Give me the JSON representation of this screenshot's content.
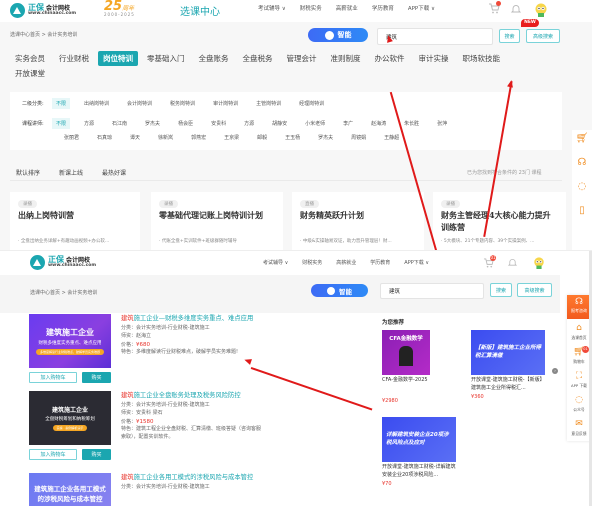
{
  "screen1": {
    "logo": {
      "brand": "正保",
      "brand_sub": "会计网校",
      "url": "www.chinaacc.com"
    },
    "anniversary": {
      "number": "25",
      "word": "周年",
      "years": "2000-2025"
    },
    "site_title": "选课中心",
    "nav": [
      "考试辅导 ∨",
      "财税实务",
      "高薪就业",
      "学历教育",
      "APP下载 ∨"
    ],
    "breadcrumb": "选课中心首页 > 会计实务培训",
    "smart_label": "智能",
    "search": {
      "value": "建筑",
      "button": "搜索",
      "advanced": "高级搜索",
      "new_badge": "NEW"
    },
    "categories": [
      {
        "label": "实务会员",
        "active": false
      },
      {
        "label": "行业财税",
        "active": false
      },
      {
        "label": "岗位特训",
        "active": true
      },
      {
        "label": "零基础入门",
        "active": false
      },
      {
        "label": "全盘账务",
        "active": false
      },
      {
        "label": "全盘税务",
        "active": false
      },
      {
        "label": "管理会计",
        "active": false
      },
      {
        "label": "准则制度",
        "active": false
      },
      {
        "label": "办公软件",
        "active": false
      },
      {
        "label": "审计实操",
        "active": false
      },
      {
        "label": "职场软技能",
        "active": false
      },
      {
        "label": "开放课堂",
        "active": false
      }
    ],
    "filters": {
      "subcategory_label": "二级分类:",
      "subcategories": [
        "不限",
        "出纳岗特训",
        "会计岗特训",
        "税务岗特训",
        "审计岗特训",
        "主管岗特训",
        "经理岗特训"
      ],
      "teacher_label": "课程讲师:",
      "teachers_row1": [
        "不限",
        "方源",
        "石江南",
        "罗杰夫",
        "杨会臣",
        "安贵科",
        "方源",
        "胡静安",
        "小米老师",
        "李广",
        "赵海涛",
        "朱长胜",
        "张萍"
      ],
      "teachers_row2": [
        "张丽君",
        "石真琼",
        "谭天",
        "徐新岚",
        "郭燕宏",
        "王京梁",
        "邮毅",
        "王玉杨",
        "罗杰夫",
        "周镜娟",
        "王静超"
      ]
    },
    "sort": [
      "默认排序",
      "新课上线",
      "最热好课"
    ],
    "result_count": "已为您找到符合条件的 23门 课程",
    "courses": [
      {
        "tag": "录播",
        "title": "出纳上岗特训营",
        "desc": "· 全盘出纳业务详解+有趣动画视频+办公软..."
      },
      {
        "tag": "录播",
        "title": "零基础代理记账上岗特训计划",
        "desc": "· 代账全盘+实训软件+班级群随时辅导"
      },
      {
        "tag": "直播",
        "title": "财务精英跃升计划",
        "desc": "· 中级&实操轴易双证，助力晋升管理层！财..."
      },
      {
        "tag": "录播",
        "title": "财务主管经理4大核心能力提升训练营",
        "desc": "· 5大模块、21个专题内容、39个实操案例、..."
      }
    ],
    "cart_badge": "",
    "side_icons": [
      "cart-icon",
      "service-icon",
      "chat-icon",
      "phone-icon"
    ]
  },
  "screen2": {
    "logo": {
      "brand": "正保",
      "brand_sub": "会计网校",
      "url": "www.chinaacc.com"
    },
    "nav": [
      "考试辅导 ∨",
      "财税实务",
      "高薪就业",
      "学历教育",
      "APP下载 ∨"
    ],
    "cart_badge": "01",
    "breadcrumb": "选课中心首页 > 会计实务培训",
    "smart_label": "智能",
    "search": {
      "value": "建筑",
      "button": "搜索",
      "advanced": "高级搜索"
    },
    "results": [
      {
        "thumb_main": "建筑施工企业",
        "thumb_sub": "财税多维度实务重点、难点应用",
        "thumb_pill": "多维度解读行业财税难点，破解学员实务难题",
        "title_highlight": "建筑",
        "title_rest": "施工企业—财税多维度实务重点、难点应用",
        "category": "分类：会计实务培训-行业财税-建筑施工",
        "teacher": "师资：赵海立",
        "price_label": "价格：",
        "price": "¥680",
        "feature": "特色：多维度解读行业财税难点，破解学员实务难题!",
        "cart_button": "加入购物车",
        "buy_button": "购买"
      },
      {
        "thumb_main": "建筑施工企业",
        "thumb_sub": "全盘财税筹划和纳税筹划",
        "thumb_pill": "实操 · 案例解析演示",
        "title_highlight": "建筑",
        "title_rest": "施工企业全盘账务处理及税务风险防控",
        "category": "分类：会计实务培训-行业财税-建筑施工",
        "teacher": "师资：安贵科 梁石",
        "price_label": "价格：",
        "price": "¥1580",
        "feature": "特色：建筑工程企业全盘财税、汇算清缴、班级答疑（咨询客服索取），配置实训软件。",
        "cart_button": "加入购物车",
        "buy_button": "购买"
      },
      {
        "thumb_main": "建筑施工企业各用工模式",
        "thumb_sub": "的涉税风险与成本管控",
        "title_highlight": "建筑",
        "title_rest": "施工企业各用工模式的涉税风险与成本管控",
        "category": "分类：会计实务培训-行业财税-建筑施工"
      }
    ],
    "recommend": {
      "title": "为您推荐",
      "items": [
        {
          "thumb_text": "CFA金融数学",
          "name": "CFA-金融数学-2025",
          "price": "¥2980"
        },
        {
          "thumb_text": "【新版】建筑施工企业所得税汇算清缴",
          "name": "开放课堂-建筑施工财税-【新版】建筑施工企业所得税汇...",
          "price": "¥360"
        },
        {
          "thumb_text": "详解建筑安装企业20项涉税风险点及应对",
          "name": "开放课堂-建筑施工财税-详解建筑安装企业20项涉税风险...",
          "price": "¥70"
        }
      ]
    },
    "side": {
      "consult": "报考咨询",
      "items": [
        {
          "icon": "home-icon",
          "label": "选课首页"
        },
        {
          "icon": "cart-icon",
          "label": "购物车",
          "badge": "01"
        },
        {
          "icon": "scan-icon",
          "label": "APP 下载"
        },
        {
          "icon": "wechat-icon",
          "label": "公众号"
        },
        {
          "icon": "mail-icon",
          "label": "意见反馈"
        }
      ]
    }
  }
}
